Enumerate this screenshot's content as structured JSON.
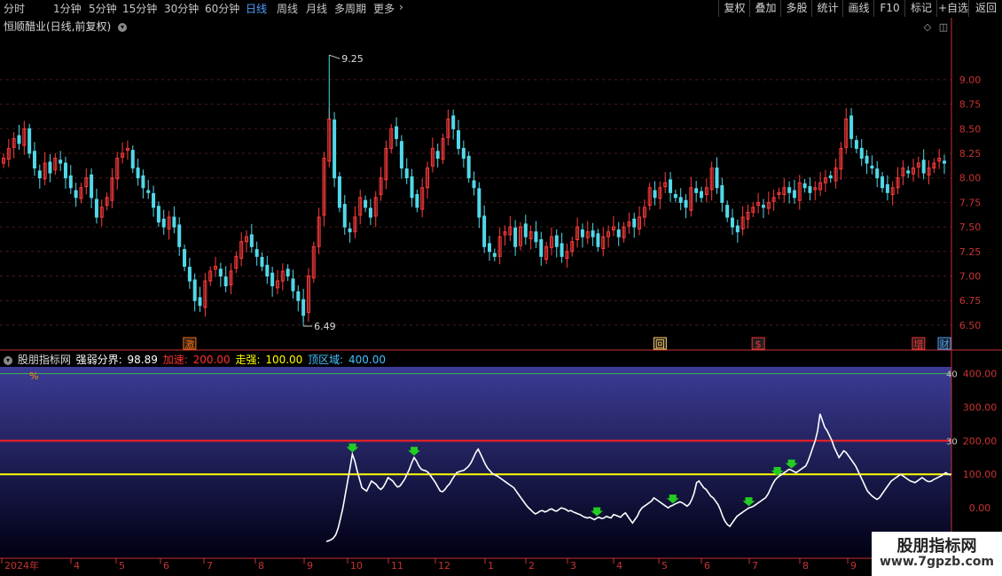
{
  "toolbar": {
    "periods": [
      "分时",
      "1分钟",
      "5分钟",
      "15分钟",
      "30分钟",
      "60分钟",
      "日线",
      "周线",
      "月线",
      "多周期",
      "更多"
    ],
    "active_period": "日线",
    "more_arrow": "chevron-right-icon",
    "buttons": [
      "复权",
      "叠加",
      "多股",
      "统计",
      "画线",
      "F10",
      "标记",
      "+自选",
      "返回"
    ]
  },
  "stock": {
    "title": "恒顺醋业(日线,前复权)",
    "high_label": "9.25",
    "low_label": "6.49"
  },
  "indicator": {
    "name": "股朋指标网",
    "label_ruo": "强弱分界:",
    "value_ruo": "98.89",
    "label_jiasu": "加速:",
    "value_jiasu": "200.00",
    "label_zouqiang": "走强:",
    "value_zouqiang": "100.00",
    "label_ding": "顶区域:",
    "value_ding": "400.00",
    "percent_label": "%",
    "right_marks": [
      "40",
      "30"
    ]
  },
  "events": [
    {
      "label": "激",
      "x_index": 36,
      "color": "#ff6a00"
    },
    {
      "label": "回",
      "x_index": 127,
      "color": "#ffcc66"
    },
    {
      "label": "$",
      "x_index": 146,
      "color": "#ff3030"
    },
    {
      "label": "增",
      "x_index": 177,
      "color": "#ff3030"
    },
    {
      "label": "财",
      "x_index": 182,
      "color": "#40a0ff"
    }
  ],
  "colors": {
    "up": "#ff3c3c",
    "down": "#52d8e8",
    "ind_line": "#ffffff",
    "line_400": "#3cb44b",
    "line_200": "#ff2020",
    "line_100": "#ffff00",
    "arrow": "#22cc22",
    "axis": "#c83232"
  },
  "chart_data": [
    {
      "type": "candlestick",
      "title": "恒顺醋业(日线,前复权)",
      "ylim": [
        6.4,
        9.45
      ],
      "yticks": [
        "9.00",
        "8.75",
        "8.50",
        "8.25",
        "8.00",
        "7.75",
        "7.50",
        "7.25",
        "7.00",
        "6.75",
        "6.50"
      ],
      "close": [
        8.2,
        8.3,
        8.4,
        8.35,
        8.5,
        8.25,
        8.1,
        8.0,
        8.15,
        8.05,
        8.2,
        8.15,
        8.0,
        7.9,
        7.8,
        7.9,
        8.0,
        7.8,
        7.6,
        7.7,
        7.8,
        8.0,
        8.2,
        8.25,
        8.3,
        8.1,
        8.0,
        7.9,
        7.85,
        7.7,
        7.55,
        7.5,
        7.6,
        7.5,
        7.3,
        7.1,
        6.95,
        6.75,
        6.7,
        6.95,
        7.05,
        7.1,
        7.0,
        6.9,
        7.05,
        7.2,
        7.35,
        7.4,
        7.3,
        7.2,
        7.1,
        7.0,
        6.9,
        6.95,
        7.05,
        7.0,
        6.85,
        6.75,
        6.6,
        7.0,
        7.3,
        7.6,
        8.2,
        8.6,
        8.0,
        7.7,
        7.5,
        7.45,
        7.6,
        7.8,
        7.7,
        7.6,
        7.8,
        8.0,
        8.3,
        8.5,
        8.4,
        8.1,
        8.0,
        7.8,
        7.7,
        7.9,
        8.1,
        8.3,
        8.2,
        8.4,
        8.6,
        8.5,
        8.3,
        8.2,
        8.0,
        7.9,
        7.6,
        7.3,
        7.25,
        7.2,
        7.4,
        7.45,
        7.5,
        7.3,
        7.5,
        7.4,
        7.45,
        7.35,
        7.2,
        7.3,
        7.4,
        7.3,
        7.2,
        7.25,
        7.35,
        7.5,
        7.4,
        7.45,
        7.4,
        7.3,
        7.4,
        7.45,
        7.5,
        7.4,
        7.5,
        7.55,
        7.5,
        7.6,
        7.7,
        7.9,
        7.8,
        7.9,
        7.95,
        7.85,
        7.8,
        7.75,
        7.7,
        7.9,
        7.85,
        7.8,
        7.9,
        8.1,
        7.9,
        7.75,
        7.6,
        7.5,
        7.45,
        7.6,
        7.65,
        7.7,
        7.75,
        7.7,
        7.75,
        7.8,
        7.85,
        7.9,
        7.85,
        7.8,
        7.95,
        7.9,
        7.85,
        7.9,
        7.95,
        8.0,
        8.0,
        8.1,
        8.3,
        8.6,
        8.4,
        8.3,
        8.2,
        8.15,
        8.1,
        8.0,
        7.9,
        7.85,
        7.9,
        8.0,
        8.1,
        8.05,
        8.1,
        8.15,
        8.05,
        8.1,
        8.15,
        8.2,
        8.15
      ],
      "high_label": "9.25",
      "low_label": "6.49"
    },
    {
      "type": "line",
      "name": "股朋指标网",
      "ylim": [
        -100,
        420
      ],
      "yticks": [
        "400.00",
        "300.00",
        "200.00",
        "100.00",
        "0.00"
      ],
      "values": [
        -100,
        -98,
        -95,
        -90,
        -80,
        -60,
        -30,
        0,
        40,
        80,
        120,
        160,
        140,
        110,
        85,
        60,
        55,
        50,
        65,
        80,
        75,
        70,
        60,
        55,
        62,
        75,
        90,
        85,
        80,
        70,
        62,
        65,
        75,
        85,
        100,
        115,
        135,
        150,
        140,
        125,
        115,
        112,
        110,
        105,
        95,
        85,
        75,
        62,
        50,
        48,
        55,
        65,
        72,
        85,
        95,
        105,
        108,
        110,
        112,
        118,
        125,
        135,
        150,
        165,
        175,
        160,
        145,
        130,
        118,
        110,
        102,
        98,
        95,
        90,
        85,
        80,
        75,
        70,
        65,
        60,
        50,
        40,
        30,
        20,
        10,
        2,
        -5,
        -12,
        -18,
        -15,
        -10,
        -8,
        -12,
        -10,
        -5,
        -3,
        -8,
        -10,
        -5,
        0,
        -2,
        -5,
        -10,
        -8,
        -12,
        -15,
        -18,
        -20,
        -25,
        -28,
        -30,
        -28,
        -32,
        -35,
        -30,
        -28,
        -32,
        -30,
        -25,
        -28,
        -30,
        -20,
        -22,
        -25,
        -28,
        -20,
        -15,
        -25,
        -35,
        -45,
        -35,
        -25,
        -10,
        0,
        5,
        10,
        15,
        20,
        30,
        25,
        20,
        15,
        10,
        5,
        0,
        5,
        8,
        12,
        15,
        18,
        15,
        10,
        5,
        12,
        25,
        45,
        75,
        80,
        70,
        60,
        55,
        45,
        35,
        30,
        20,
        10,
        -5,
        -25,
        -40,
        -50,
        -55,
        -45,
        -35,
        -25,
        -20,
        -15,
        -10,
        -5,
        0,
        2,
        5,
        10,
        15,
        20,
        25,
        30,
        40,
        55,
        70,
        82,
        90,
        95,
        100,
        105,
        110,
        115,
        112,
        108,
        105,
        110,
        115,
        120,
        125,
        140,
        160,
        180,
        200,
        230,
        280,
        260,
        240,
        230,
        215,
        200,
        180,
        165,
        150,
        160,
        170,
        165,
        155,
        145,
        135,
        125,
        110,
        95,
        80,
        65,
        50,
        42,
        35,
        30,
        25,
        30,
        40,
        50,
        60,
        70,
        80,
        85,
        90,
        95,
        100,
        95,
        90,
        85,
        80,
        78,
        75,
        80,
        85,
        90,
        85,
        80,
        78,
        80,
        85,
        88,
        92,
        95,
        100,
        105,
        100,
        98
      ]
    }
  ],
  "xaxis": {
    "labels": [
      "2024年",
      "4",
      "5",
      "6",
      "7",
      "8",
      "9",
      "10",
      "11",
      "12",
      "1",
      "2",
      "3",
      "4",
      "5",
      "6",
      "7",
      "8",
      "9"
    ]
  }
}
